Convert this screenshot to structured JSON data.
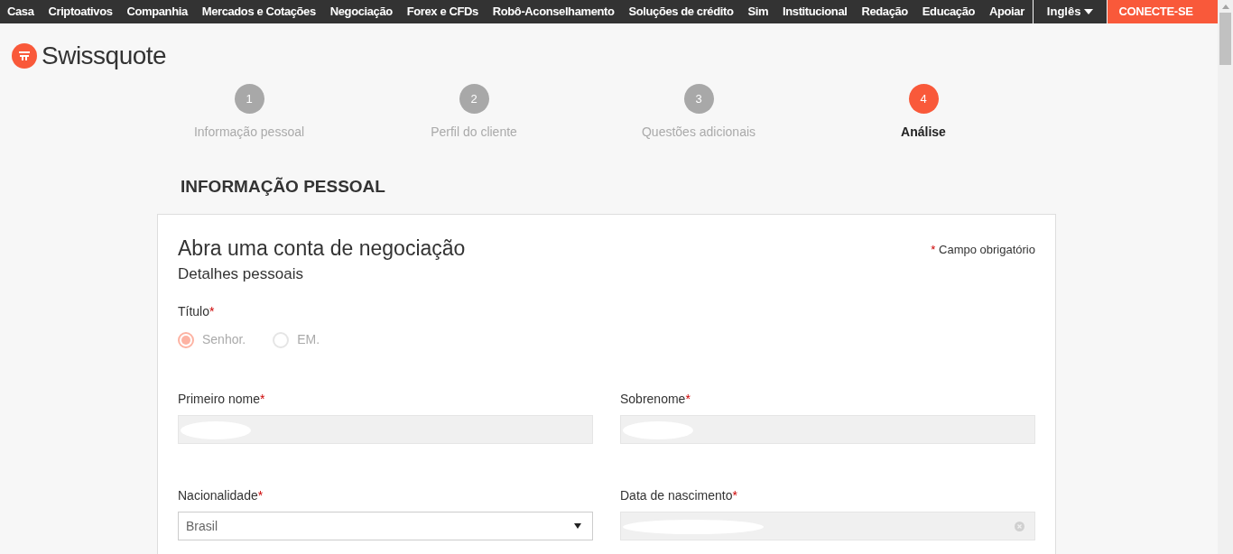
{
  "nav": {
    "items": [
      "Casa",
      "Criptoativos",
      "Companhia",
      "Mercados e Cotações",
      "Negociação",
      "Forex e CFDs",
      "Robô-Aconselhamento",
      "Soluções de crédito",
      "Sim",
      "Institucional",
      "Redação",
      "Educação",
      "Apoiar"
    ],
    "language": "Inglês",
    "connect": "CONECTE-SE"
  },
  "logo": "Swissquote",
  "steps": [
    {
      "number": "1",
      "label": "Informação pessoal",
      "selected": false
    },
    {
      "number": "2",
      "label": "Perfil do cliente",
      "selected": false
    },
    {
      "number": "3",
      "label": "Questões adicionais",
      "selected": false
    },
    {
      "number": "4",
      "label": "Análise",
      "selected": true
    }
  ],
  "section_title": "INFORMAÇÃO PESSOAL",
  "form": {
    "title": "Abra uma conta de negociação",
    "subtitle": "Detalhes pessoais",
    "required_mark": "*",
    "required_note": "Campo obrigatório",
    "title_field": {
      "label": "Título",
      "options": [
        {
          "label": "Senhor.",
          "selected": true
        },
        {
          "label": "EM.",
          "selected": false
        }
      ]
    },
    "fields": [
      {
        "label": "Primeiro nome",
        "kind": "text",
        "disabled": true,
        "redacted": true
      },
      {
        "label": "Sobrenome",
        "kind": "text",
        "disabled": true,
        "redacted": true
      },
      {
        "label": "Nacionalidade",
        "kind": "select",
        "disabled": false,
        "value": "Brasil"
      },
      {
        "label": "Data de nascimento",
        "kind": "date",
        "disabled": true,
        "redacted": true
      }
    ]
  }
}
